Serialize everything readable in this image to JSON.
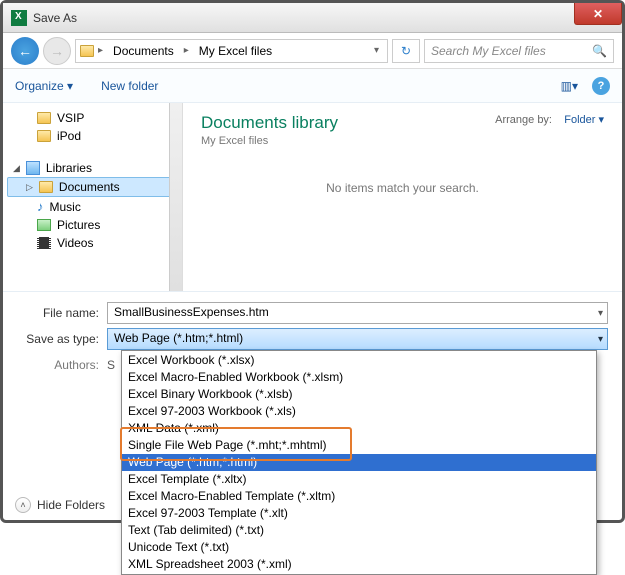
{
  "window": {
    "title": "Save As",
    "close_label": "✕"
  },
  "nav": {
    "breadcrumb": {
      "seg1": "Documents",
      "seg2": "My Excel files"
    },
    "search_placeholder": "Search My Excel files"
  },
  "toolbar": {
    "organize": "Organize ▾",
    "new_folder": "New folder"
  },
  "tree": {
    "items": [
      {
        "label": "VSIP"
      },
      {
        "label": "iPod"
      },
      {
        "label": "Libraries"
      },
      {
        "label": "Documents"
      },
      {
        "label": "Music"
      },
      {
        "label": "Pictures"
      },
      {
        "label": "Videos"
      }
    ]
  },
  "library": {
    "title": "Documents library",
    "subtitle": "My Excel files",
    "arrange_label": "Arrange by:",
    "arrange_value": "Folder ▾",
    "empty": "No items match your search."
  },
  "form": {
    "filename_label": "File name:",
    "filename_value": "SmallBusinessExpenses.htm",
    "type_label": "Save as type:",
    "type_value": "Web Page (*.htm;*.html)",
    "authors_label": "Authors:",
    "authors_prefix": "S",
    "hide_folders": "Hide Folders"
  },
  "dropdown": {
    "options": [
      "Excel Workbook (*.xlsx)",
      "Excel Macro-Enabled Workbook (*.xlsm)",
      "Excel Binary Workbook (*.xlsb)",
      "Excel 97-2003 Workbook (*.xls)",
      "XML Data (*.xml)",
      "Single File Web Page (*.mht;*.mhtml)",
      "Web Page (*.htm;*.html)",
      "Excel Template (*.xltx)",
      "Excel Macro-Enabled Template (*.xltm)",
      "Excel 97-2003 Template (*.xlt)",
      "Text (Tab delimited) (*.txt)",
      "Unicode Text (*.txt)",
      "XML Spreadsheet 2003 (*.xml)"
    ],
    "selected_index": 6
  }
}
